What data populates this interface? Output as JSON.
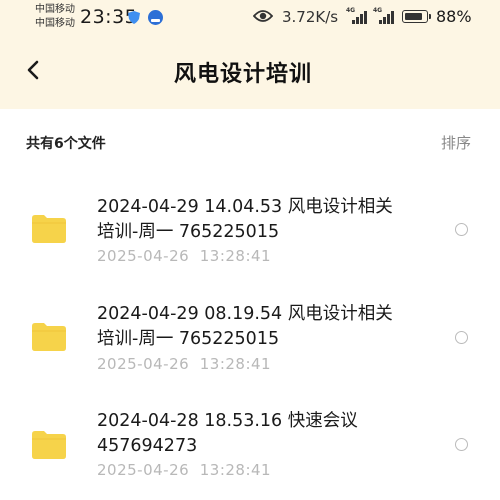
{
  "status_bar": {
    "carrier_1": "中国移动",
    "carrier_2": "中国移动",
    "time": "23:35",
    "network_speed": "3.72K/s",
    "signal_1_tag": "4G",
    "signal_2_tag": "4G",
    "battery_percent": "88%",
    "battery_level": 0.88,
    "icons": [
      "shield-icon",
      "app-badge-icon",
      "eye-icon",
      "signal-icon",
      "signal-icon",
      "battery-icon"
    ]
  },
  "header": {
    "back_icon": "chevron-left-icon",
    "title": "风电设计培训"
  },
  "list_header": {
    "count_label": "共有6个文件",
    "sort_label": "排序"
  },
  "files": [
    {
      "name_line1": "2024-04-29 14.04.53 风电设计相关",
      "name_line2": "培训-周一 765225015",
      "date": "2025-04-26",
      "time": "13:28:41",
      "icon": "folder-icon",
      "selected": false
    },
    {
      "name_line1": "2024-04-29 08.19.54 风电设计相关",
      "name_line2": "培训-周一 765225015",
      "date": "2025-04-26",
      "time": "13:28:41",
      "icon": "folder-icon",
      "selected": false
    },
    {
      "name_line1": "2024-04-28 18.53.16 快速会议",
      "name_line2": "457694273",
      "date": "2025-04-26",
      "time": "13:28:41",
      "icon": "folder-icon",
      "selected": false
    }
  ],
  "colors": {
    "header_background": "#fdf6e4",
    "folder": "#f6d34a",
    "shield": "#3f8ff0",
    "secondary_text": "#b8b8b8"
  }
}
